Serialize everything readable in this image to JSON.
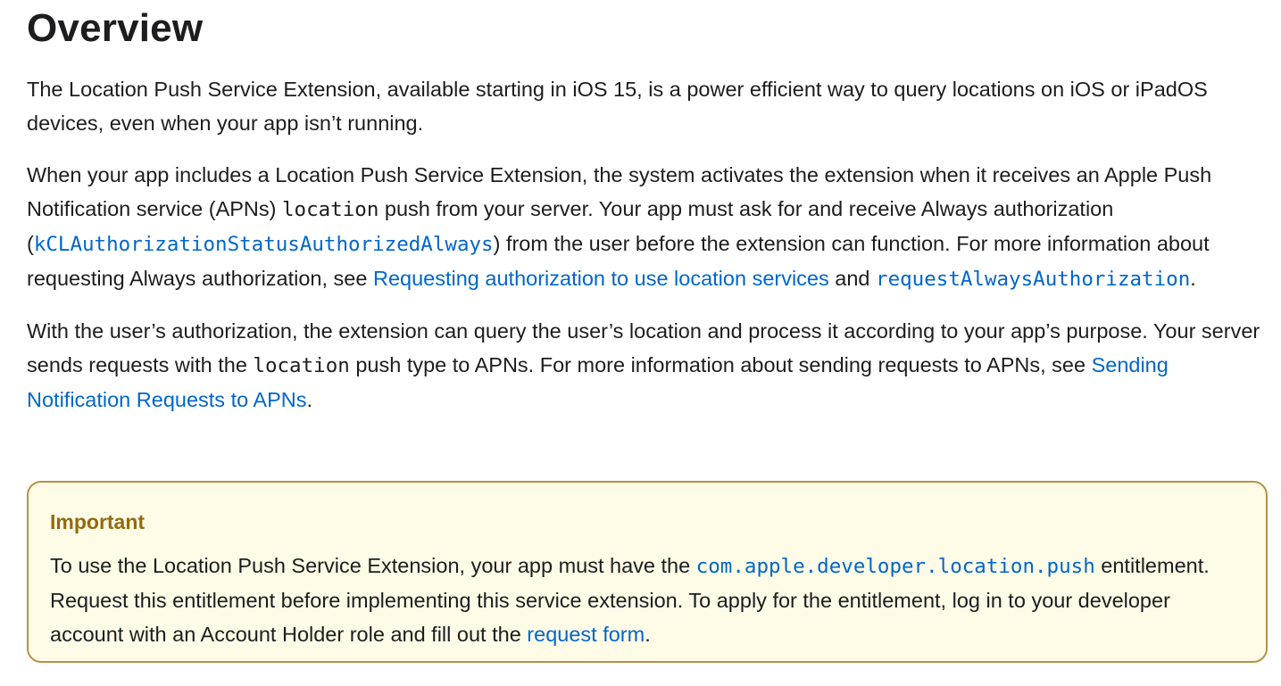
{
  "heading": "Overview",
  "para1": {
    "text": "The Location Push Service Extension, available starting in iOS 15, is a power efficient way to query locations on iOS or iPadOS devices, even when your app isn’t running."
  },
  "para2": {
    "t1": "When your app includes a Location Push Service Extension, the system activates the extension when it receives an Apple Push Notification service (APNs) ",
    "code1": "location",
    "t2": " push from your server. Your app must ask for and receive Always authorization (",
    "link1": "kCLAuthorizationStatusAuthorizedAlways",
    "t3": ") from the user before the extension can function. For more information about requesting Always authorization, see ",
    "link2": "Requesting authorization to use location services",
    "t4": " and ",
    "link3": "requestAlwaysAuthorization",
    "t5": "."
  },
  "para3": {
    "t1": "With the user’s authorization, the extension can query the user’s location and process it according to your app’s purpose. Your server sends requests with the ",
    "code1": "location",
    "t2": " push type to APNs. For more information about sending requests to APNs, see ",
    "link1": "Sending Notification Requests to APNs",
    "t3": "."
  },
  "aside": {
    "label": "Important",
    "t1": "To use the Location Push Service Extension, your app must have the ",
    "link1": "com.apple.developer.location.push",
    "t2": " entitlement. Request this entitlement before implementing this service extension. To apply for the entitlement, log in to your developer account with an Account Holder role and fill out the ",
    "link2": "request form",
    "t3": "."
  },
  "colors": {
    "text": "#1d1d1f",
    "link": "#0066cc",
    "aside_bg": "#fefbe6",
    "aside_border": "#b6914a",
    "aside_label": "#936b0e"
  }
}
